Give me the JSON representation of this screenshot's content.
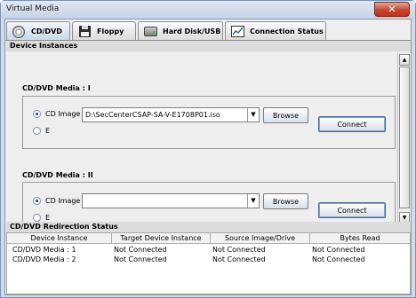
{
  "window": {
    "title": "Virtual Media",
    "close_glyph": "✕"
  },
  "tabs": [
    {
      "label": "CD/DVD",
      "icon": "cd-dvd-icon"
    },
    {
      "label": "Floppy",
      "icon": "floppy-icon"
    },
    {
      "label": "Hard Disk/USB",
      "icon": "hard-disk-icon"
    },
    {
      "label": "Connection Status",
      "icon": "connection-status-icon"
    }
  ],
  "instances": {
    "header": "Device Instances",
    "media": [
      {
        "label": "CD/DVD Media : I",
        "cd_image_label": "CD Image",
        "cd_image_value": "D:\\SecCenterCSAP-SA-V-E1708P01.iso",
        "drive_label": "E",
        "browse_label": "Browse",
        "connect_label": "Connect"
      },
      {
        "label": "CD/DVD Media : II",
        "cd_image_label": "CD Image",
        "cd_image_value": "",
        "drive_label": "E",
        "browse_label": "Browse",
        "connect_label": "Connect"
      }
    ]
  },
  "status": {
    "header": "CD/DVD Redirection Status",
    "columns": [
      "Device Instance",
      "Target Device Instance",
      "Source Image/Drive",
      "Bytes Read"
    ],
    "rows": [
      [
        "CD/DVD Media :  1",
        "Not Connected",
        "Not Connected",
        "Not Connected"
      ],
      [
        "CD/DVD Media :  2",
        "Not Connected",
        "Not Connected",
        "Not Connected"
      ]
    ]
  },
  "scrollbar": {
    "up_glyph": "▲",
    "down_glyph": "▼"
  },
  "combo_arrow_glyph": "▼",
  "colors": {
    "title_bar": "#cfdbe9",
    "close_button": "#c9452f",
    "active_tab": "#c9d7e8"
  }
}
